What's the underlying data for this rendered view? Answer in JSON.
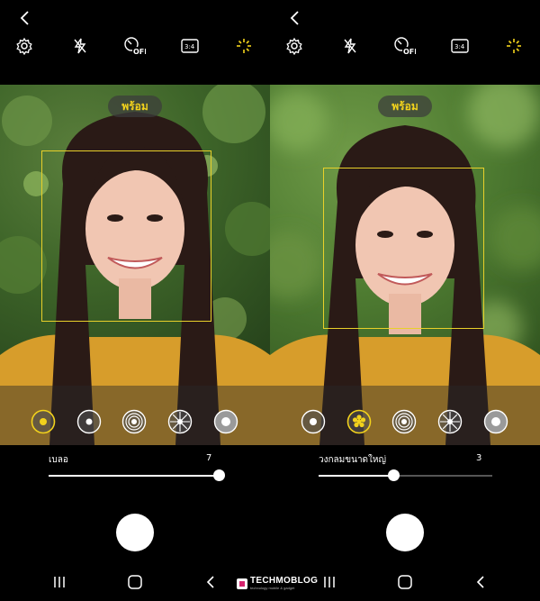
{
  "colors": {
    "accent": "#f2d21c",
    "background": "#000000",
    "focus_box": "#e8d02a"
  },
  "screens": [
    {
      "status_label": "พร้อม",
      "toolbar_icons": [
        "settings-icon",
        "flash-off-icon",
        "timer-off-icon",
        "aspect-ratio-icon",
        "live-focus-icon"
      ],
      "aspect_ratio_label": "3:4",
      "timer_label": "OFF",
      "effects": [
        "blur",
        "big-circle",
        "spin",
        "zoom",
        "color-point"
      ],
      "selected_effect": "blur",
      "slider_label": "เบลอ",
      "slider_value": "7",
      "slider_level": 0.98
    },
    {
      "status_label": "พร้อม",
      "toolbar_icons": [
        "settings-icon",
        "flash-off-icon",
        "timer-off-icon",
        "aspect-ratio-icon",
        "live-focus-icon"
      ],
      "aspect_ratio_label": "3:4",
      "timer_label": "OFF",
      "effects": [
        "blur",
        "big-circle",
        "spin",
        "zoom",
        "color-point"
      ],
      "selected_effect": "big-circle",
      "slider_label": "วงกลมขนาดใหญ่",
      "slider_value": "3",
      "slider_level": 0.43
    }
  ],
  "nav_icons": [
    "recent-apps-icon",
    "home-icon",
    "back-icon"
  ],
  "watermark": {
    "name": "TECHMOBLOG",
    "tagline": "technology mobile & gadget"
  }
}
